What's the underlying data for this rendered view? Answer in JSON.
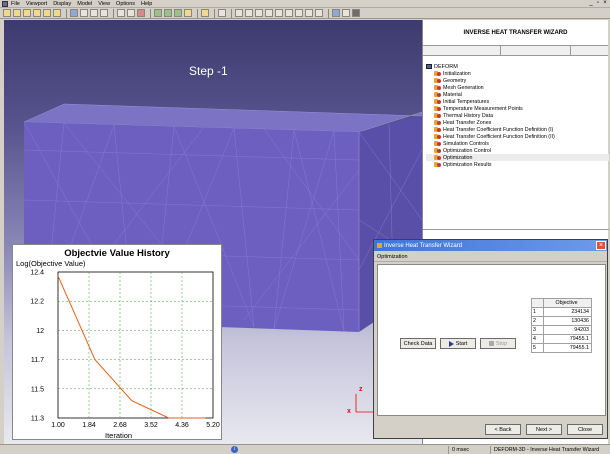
{
  "menu": [
    "File",
    "Viewport",
    "Display",
    "Model",
    "View",
    "Options",
    "Help"
  ],
  "window_controls": [
    "_",
    "▫",
    "×"
  ],
  "viewport": {
    "step_label": "Step  -1",
    "axis_z": "z",
    "axis_x": "x"
  },
  "chart_data": {
    "type": "line",
    "title": "Objectvie Value History",
    "ylabel": "Log(Objective Value)",
    "xlabel": "Iteration",
    "x": [
      1,
      2,
      3,
      4,
      5
    ],
    "series": [
      {
        "values": [
          12.37,
          11.74,
          11.43,
          11.3,
          11.3
        ],
        "color": "#e2601a"
      }
    ],
    "xlim": [
      1.0,
      5.2
    ],
    "ylim": [
      11.3,
      12.4
    ],
    "xticks": [
      "1.00",
      "1.84",
      "2.68",
      "3.52",
      "4.36",
      "5.20"
    ],
    "yticks": [
      "12.4",
      "12.2",
      "12",
      "11.7",
      "11.5",
      "11.3"
    ],
    "grid": true
  },
  "tree": {
    "header": "INVERSE HEAT TRANSFER WIZARD",
    "root": "DEFORM",
    "items": [
      "Initialization",
      "Geometry",
      "Mesh Generation",
      "Material",
      "Initial Temperatures",
      "Temperature Measurement Points",
      "Thermal History Data",
      "Heat Transfer Zones",
      "Heat Transfer Coefficient Function Definition (I)",
      "Heat Transfer Coefficient Function Definition (II)",
      "Simulation Controls",
      "Optimization Control",
      "Optimization",
      "Optimization Results"
    ],
    "selected_index": 12
  },
  "dialog": {
    "title": "Inverse Heat Transfer Wizard",
    "subtitle": "Optimization",
    "check_data": "Check Data",
    "start": "Start",
    "stop": "Stop",
    "table_header": "Objective",
    "rows": [
      {
        "idx": "1",
        "value": "234134"
      },
      {
        "idx": "2",
        "value": "130436"
      },
      {
        "idx": "3",
        "value": "94203"
      },
      {
        "idx": "4",
        "value": "79455.1"
      },
      {
        "idx": "5",
        "value": "79455.1"
      }
    ],
    "back": "< Back",
    "next": "Next >",
    "close": "Close"
  },
  "status": {
    "info_icon": "i",
    "time": "0 msec",
    "app": "DEFORM-3D  -  Inverse Heat Transfer Wizard"
  }
}
